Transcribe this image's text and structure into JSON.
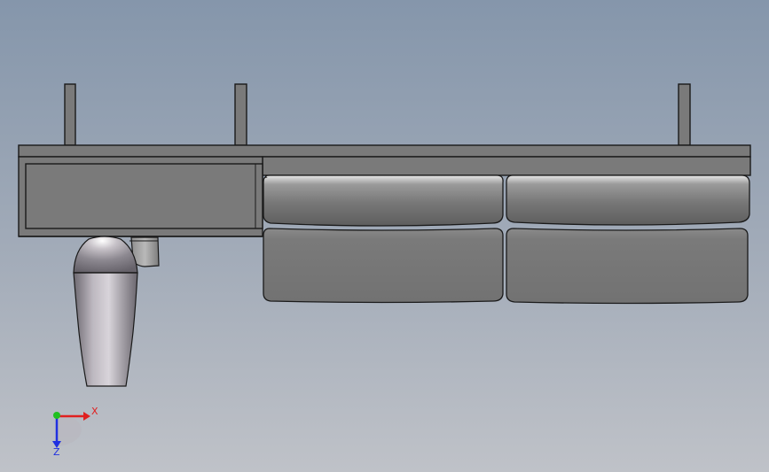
{
  "scene": {
    "name": "cad-model-viewport",
    "colors": {
      "background_top": "#8596ab",
      "background_bottom": "#bfc2c8",
      "part_fill": "#7a7a7a",
      "part_edge": "#1a1a1a",
      "cushion_highlight": "#e6e6e6",
      "pendant_highlight": "#f2f2f2",
      "axis_x": "#e02020",
      "axis_y": "#20c020",
      "axis_z": "#2030e0"
    }
  },
  "triad": {
    "x_label": "X",
    "z_label": "Z",
    "icon": "coordinate-triad-icon"
  }
}
